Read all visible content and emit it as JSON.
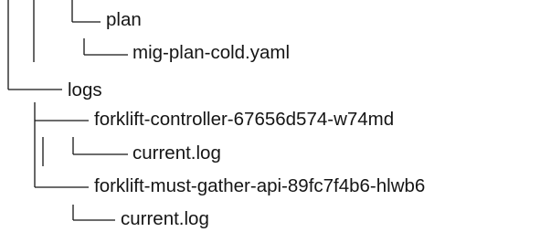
{
  "tree": {
    "entries": [
      {
        "label": "plan"
      },
      {
        "label": "mig-plan-cold.yaml"
      },
      {
        "label": "logs"
      },
      {
        "label": "forklift-controller-67656d574-w74md"
      },
      {
        "label": "current.log"
      },
      {
        "label": "forklift-must-gather-api-89fc7f4b6-hlwb6"
      },
      {
        "label": "current.log"
      }
    ]
  },
  "colors": {
    "text": "#151515",
    "connector": "#151515"
  }
}
